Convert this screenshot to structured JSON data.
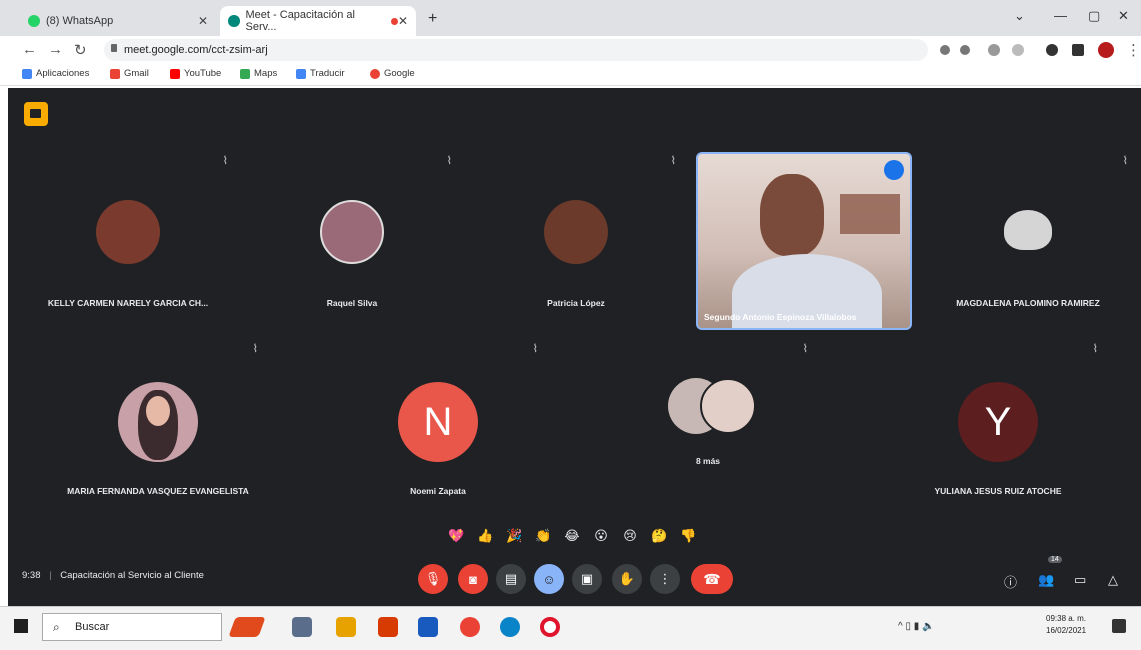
{
  "browser": {
    "tabs": [
      {
        "label": "(8) WhatsApp"
      },
      {
        "label": "Meet - Capacitación al Serv..."
      }
    ],
    "new_tab_label": "+",
    "url": "meet.google.com/cct-zsim-arj",
    "bookmarks": [
      {
        "label": "Aplicaciones",
        "color": "#4285f4"
      },
      {
        "label": "Gmail",
        "color": "#ea4335"
      },
      {
        "label": "YouTube",
        "color": "#ff0000"
      },
      {
        "label": "Maps",
        "color": "#34a853"
      },
      {
        "label": "Traducir",
        "color": "#4285f4"
      },
      {
        "label": "Google",
        "color": "#ea4335"
      }
    ]
  },
  "meet": {
    "participants": [
      {
        "name": "KELLY CARMEN NARELY GARCIA CH...",
        "avatar_color": "#7a3b2e",
        "kind": "photo"
      },
      {
        "name": "Raquel Silva",
        "avatar_color": "#9b6a78",
        "kind": "photo"
      },
      {
        "name": "Patricia López",
        "avatar_color": "#6b3a2a",
        "kind": "photo"
      },
      {
        "name": "MAGDALENA PALOMINO RAMIREZ",
        "avatar_color": "#e0e0e0",
        "kind": "photo"
      },
      {
        "name": "MARIA FERNANDA VASQUEZ EVANGELISTA",
        "avatar_color": "#c8a0a8",
        "kind": "photo"
      },
      {
        "name": "Noemi Zapata",
        "avatar_color": "#e8574a",
        "kind": "letter",
        "letter": "N"
      },
      {
        "name": "8 más",
        "avatar_color": "#c7b8b5",
        "kind": "photo"
      },
      {
        "name": "YULIANA JESUS RUIZ ATOCHE",
        "avatar_color": "#5c1e1e",
        "kind": "letter",
        "letter": "Y"
      }
    ],
    "video_tile_name": "Segundo Antonio Espinoza Villalobos",
    "reactions": [
      "💖",
      "👍",
      "🎉",
      "👏",
      "😂",
      "😮",
      "😢",
      "🤔",
      "👎"
    ],
    "time": "9:38",
    "meeting_title": "Capacitación al Servicio al Cliente",
    "people_count": "14"
  },
  "taskbar": {
    "search_label": "Buscar",
    "time": "09:38 a. m.",
    "date": "16/02/2021"
  }
}
